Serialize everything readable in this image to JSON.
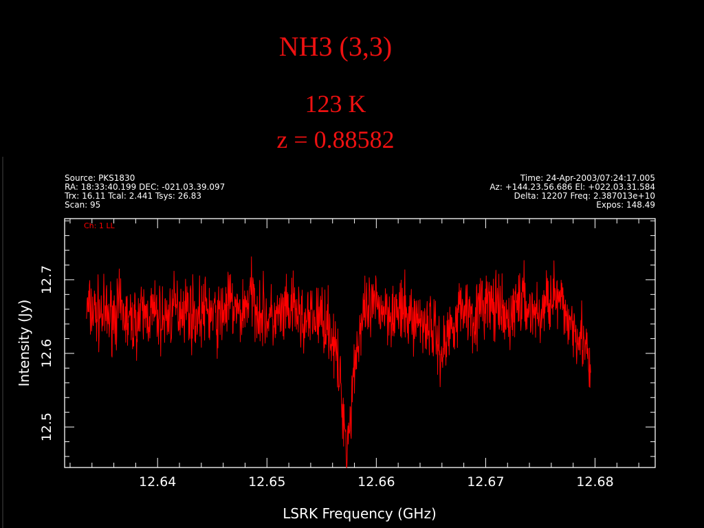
{
  "slide": {
    "title": "NH3 (3,3)",
    "temperature": "123 K",
    "redshift": "z = 0.88582"
  },
  "header": {
    "left": [
      "Source: PKS1830",
      "RA: 18:33:40.199 DEC: -021.03.39.097",
      "Trx: 16.11 Tcal: 2.441 Tsys: 26.83",
      "Scan: 95"
    ],
    "right": [
      "Time: 24-Apr-2003/07:24:17.005",
      "Az: +144.23.56.686 El: +022.03.31.584",
      "Delta: 12207 Freq: 2.387013e+10",
      "Expos: 148.49"
    ]
  },
  "colors": {
    "trace": "#ff0000",
    "axes": "#ffffff",
    "background": "#000000",
    "title": "#ee1111"
  },
  "chart_data": {
    "type": "line",
    "xlabel": "LSRK Frequency (GHz)",
    "ylabel": "Intensity (Jy)",
    "channel_label": "Ch: 1 LL",
    "xlim": [
      12.6315,
      12.6855
    ],
    "ylim": [
      12.445,
      12.783
    ],
    "xticks": [
      12.64,
      12.65,
      12.66,
      12.67,
      12.68
    ],
    "xtick_labels": [
      "12.64",
      "12.65",
      "12.66",
      "12.67",
      "12.68"
    ],
    "yticks": [
      12.5,
      12.6,
      12.7
    ],
    "ytick_labels": [
      "12.5",
      "12.6",
      "12.7"
    ],
    "series": [
      {
        "color": "#ff0000",
        "x": [
          12.6335,
          12.6345,
          12.6355,
          12.6365,
          12.6375,
          12.6385,
          12.6395,
          12.6405,
          12.6415,
          12.6425,
          12.6435,
          12.6445,
          12.6455,
          12.6465,
          12.6475,
          12.6485,
          12.6495,
          12.6505,
          12.6515,
          12.6525,
          12.6535,
          12.6545,
          12.6555,
          12.656,
          12.6565,
          12.657,
          12.6573,
          12.6576,
          12.658,
          12.6585,
          12.659,
          12.66,
          12.661,
          12.662,
          12.663,
          12.664,
          12.665,
          12.666,
          12.667,
          12.668,
          12.669,
          12.67,
          12.671,
          12.672,
          12.673,
          12.674,
          12.675,
          12.676,
          12.677,
          12.678,
          12.679,
          12.6796
        ],
        "y": [
          12.66,
          12.655,
          12.65,
          12.66,
          12.64,
          12.65,
          12.655,
          12.645,
          12.66,
          12.665,
          12.65,
          12.66,
          12.645,
          12.67,
          12.65,
          12.68,
          12.655,
          12.645,
          12.65,
          12.66,
          12.64,
          12.65,
          12.645,
          12.62,
          12.58,
          12.52,
          12.47,
          12.51,
          12.59,
          12.63,
          12.65,
          12.665,
          12.66,
          12.655,
          12.65,
          12.645,
          12.64,
          12.6,
          12.645,
          12.665,
          12.65,
          12.67,
          12.66,
          12.64,
          12.675,
          12.66,
          12.65,
          12.685,
          12.66,
          12.64,
          12.62,
          12.56
        ]
      }
    ]
  }
}
